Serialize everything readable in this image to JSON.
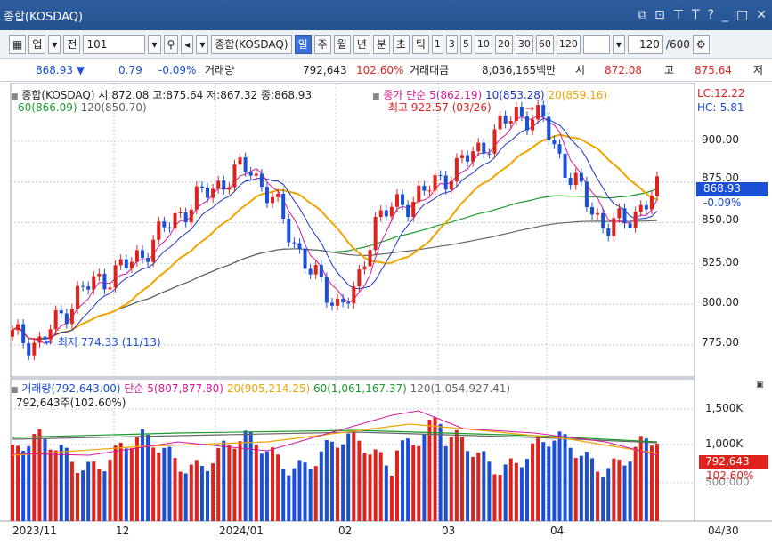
{
  "window": {
    "title": "종합(KOSDAQ)"
  },
  "toolbar": {
    "market": "업",
    "prev": "전",
    "code": "101",
    "name": "종합(KOSDAQ)",
    "periods": [
      "일",
      "주",
      "월",
      "년",
      "분",
      "초",
      "틱"
    ],
    "active_period": "일",
    "intervals": [
      "1",
      "3",
      "5",
      "10",
      "20",
      "30",
      "60",
      "120"
    ],
    "count": "120",
    "count_total": "/600"
  },
  "quote": {
    "price": "868.93",
    "change": "0.79",
    "change_pct": "-0.09%",
    "vol_label": "거래량",
    "volume": "792,643",
    "vol_pct": "102.60%",
    "amt_label": "거래대금",
    "amount": "8,036,165백만",
    "open_label": "시",
    "open": "872.08",
    "high_label": "고",
    "high": "875.64",
    "low_label": "저"
  },
  "price_panel": {
    "legend_title": "종합(KOSDAQ) 시:872.08 고:875.64 저:867.32 종:868.93",
    "ma_type": "종가 단순",
    "ma5": "5(862.19)",
    "ma10": "10(853.28)",
    "ma20": "20(859.16)",
    "ma60": "60(866.09)",
    "ma120": "120(850.70)",
    "lc": "LC:12.22",
    "hc": "HC:-5.81",
    "high_note": "최고 922.57 (03/26)",
    "low_note": "최저 774.33 (11/13)",
    "last_price": "868.93",
    "last_pct": "-0.09%",
    "yticks": [
      "900.00",
      "875.00",
      "850.00",
      "825.00",
      "800.00",
      "775.00"
    ]
  },
  "volume_panel": {
    "legend_title": "거래량(792,643.00)",
    "ma5": "단순 5(807,877.80)",
    "ma20": "20(905,214.25)",
    "ma60": "60(1,061,167.37)",
    "ma120": "120(1,054,927.41)",
    "subtitle": "792,643주(102.60%)",
    "yticks": [
      "1,500K",
      "1,000K",
      "500,000"
    ],
    "last_vol": "792,643",
    "last_pct": "102.60%"
  },
  "xaxis": {
    "labels": [
      "2023/11",
      "12",
      "2024/01",
      "02",
      "03",
      "04"
    ],
    "end_label": "04/30"
  },
  "colors": {
    "up": "#e0221c",
    "down": "#1a4fd6",
    "ma5": "#d6189a",
    "ma10": "#1b34c6",
    "ma20": "#f0a500",
    "ma60": "#1a9a2a",
    "ma120": "#666666"
  }
}
